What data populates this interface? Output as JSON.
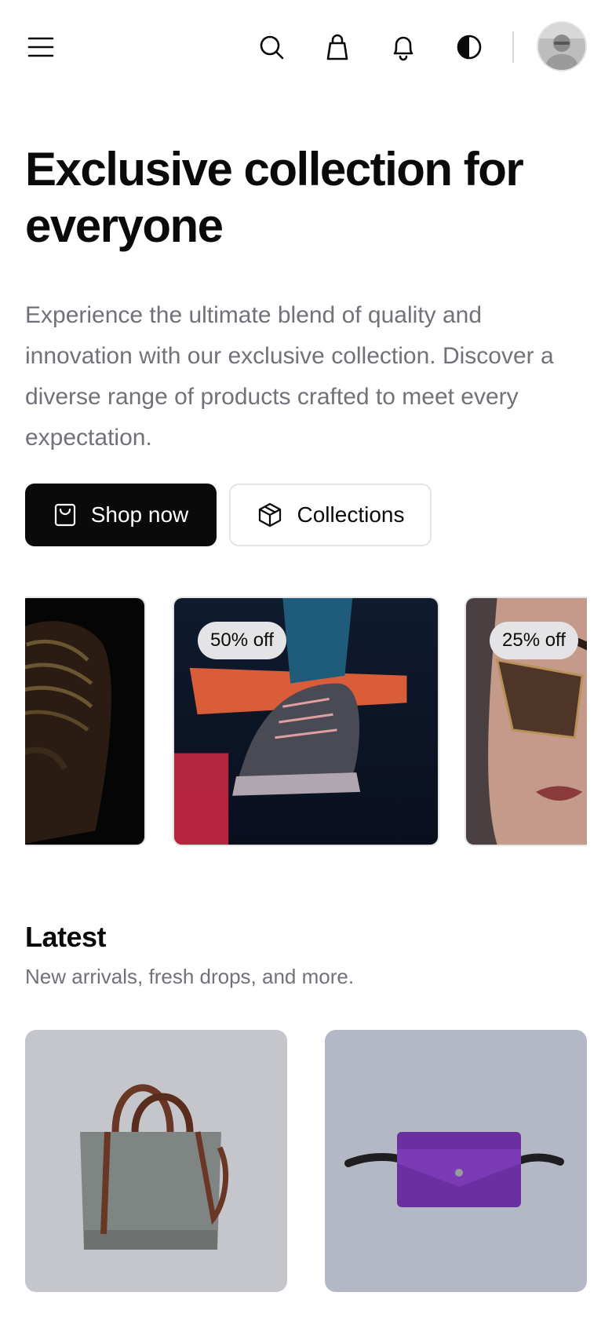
{
  "header": {
    "icons": {
      "menu": "menu-icon",
      "search": "search-icon",
      "bag": "shopping-bag-icon",
      "notifications": "bell-icon",
      "theme": "theme-toggle-icon",
      "avatar": "user-avatar"
    }
  },
  "hero": {
    "title": "Exclusive collection for everyone",
    "description": "Experience the ultimate blend of quality and innovation with our exclusive collection. Discover a diverse range of products crafted to meet every expectation.",
    "primary_button": "Shop now",
    "secondary_button": "Collections"
  },
  "carousel": {
    "slides": [
      {
        "badge": ""
      },
      {
        "badge": "50% off"
      },
      {
        "badge": "25% off"
      }
    ]
  },
  "latest": {
    "title": "Latest",
    "subtitle": "New arrivals, fresh drops, and more."
  },
  "colors": {
    "primary": "#0a0a0a",
    "muted_text": "#71717a",
    "border": "#e4e4e7",
    "background": "#ffffff"
  }
}
